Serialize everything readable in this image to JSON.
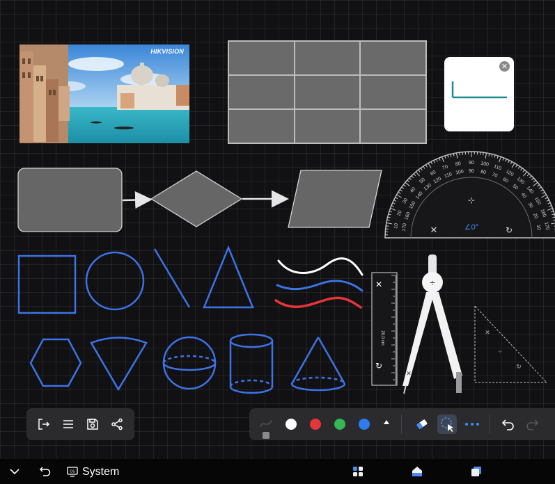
{
  "photo": {
    "brand_text": "HIKVISION"
  },
  "protractor": {
    "angle_readout": "∠0°"
  },
  "ruler": {
    "length_readout": "20.0 cm"
  },
  "taskbar": {
    "system_label": "System"
  },
  "colors": {
    "shape_blue": "#3d73e6",
    "pen_white": "#ffffff",
    "pen_red": "#e5353b",
    "pen_green": "#35b753",
    "pen_blue": "#2f7cf0",
    "note_line": "#1e8c8c"
  },
  "icons": {
    "left_toolbar": [
      "exit-icon",
      "menu-icon",
      "save-icon",
      "share-icon"
    ],
    "main_toolbar": [
      "pen-icon",
      "color-white",
      "color-red",
      "color-green",
      "color-blue",
      "expand-up-icon",
      "eraser-icon",
      "lasso-select-icon",
      "more-icon",
      "undo-icon",
      "redo-icon"
    ],
    "taskbar": [
      "chevron-down-icon",
      "back-icon",
      "system-icon",
      "apps-icon",
      "home-icon",
      "window-icon"
    ]
  }
}
